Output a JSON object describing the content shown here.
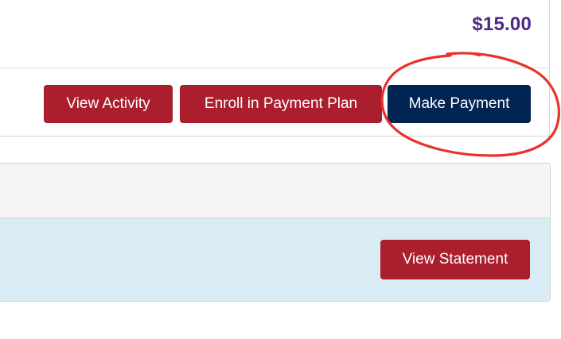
{
  "account": {
    "balance": "$15.00"
  },
  "actions": {
    "view_activity_label": "View Activity",
    "enroll_label": "Enroll in Payment Plan",
    "make_payment_label": "Make Payment"
  },
  "statement": {
    "view_statement_label": "View Statement"
  },
  "colors": {
    "primary_red": "#ab1e2d",
    "primary_navy": "#022452",
    "balance_purple": "#4b2a86",
    "annotation_red": "#e8312a",
    "statement_blue_bg": "#d9ecf6"
  }
}
